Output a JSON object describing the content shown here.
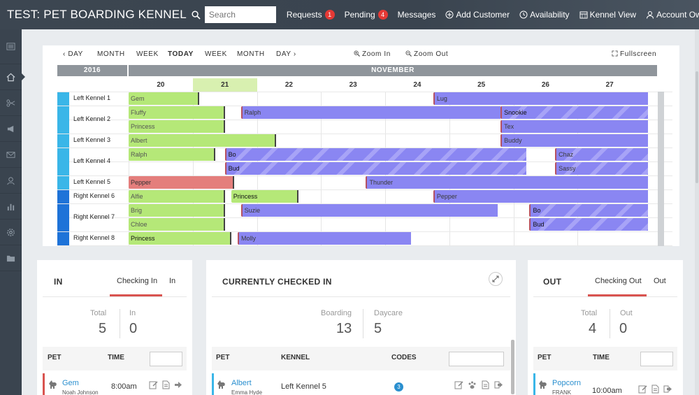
{
  "header": {
    "app_title": "TEST: PET BOARDING KENNEL",
    "search_placeholder": "Search",
    "nav": [
      {
        "label": "Requests",
        "badge": "1"
      },
      {
        "label": "Pending",
        "badge": "4"
      },
      {
        "label": "Messages"
      },
      {
        "label": "Add Customer",
        "icon": "plus-circle-icon"
      },
      {
        "label": "Availability",
        "icon": "clock-icon"
      },
      {
        "label": "Kennel View",
        "icon": "calendar-icon"
      },
      {
        "label": "Account Owner",
        "icon": "user-icon"
      }
    ]
  },
  "sidebar": {
    "items": [
      "menu-icon",
      "home-icon",
      "scissors-icon",
      "megaphone-icon",
      "envelope-icon",
      "tag-user-icon",
      "bar-chart-icon",
      "gear-icon",
      "folder-icon"
    ],
    "active": "home-icon"
  },
  "calendar": {
    "toolbar": {
      "prev_day": "DAY",
      "prev_month": "MONTH",
      "prev_week": "WEEK",
      "today": "TODAY",
      "next_week": "WEEK",
      "next_month": "MONTH",
      "next_day": "DAY",
      "zoom_in": "Zoom In",
      "zoom_out": "Zoom Out",
      "fullscreen": "Fullscreen"
    },
    "year": "2016",
    "month": "NOVEMBER",
    "days": [
      "20",
      "21",
      "22",
      "23",
      "24",
      "25",
      "26",
      "27"
    ],
    "today_day": "21",
    "kennels": [
      {
        "label": "Left Kennel 1",
        "color": "#3ab6e8"
      },
      {
        "label": "Left Kennel 2",
        "color": "#3ab6e8"
      },
      {
        "label": "Left Kennel 3",
        "color": "#3ab6e8"
      },
      {
        "label": "Left Kennel 4",
        "color": "#3ab6e8"
      },
      {
        "label": "Left Kennel 5",
        "color": "#3ab6e8"
      },
      {
        "label": "Right Kennel 6",
        "color": "#1e73d8"
      },
      {
        "label": "Right Kennel 7",
        "color": "#1e73d8"
      },
      {
        "label": "Right Kennel 8",
        "color": "#1e73d8"
      }
    ],
    "bookings": [
      {
        "pet": "Gem",
        "row": 0,
        "start": 0,
        "end": 1.1,
        "style": "green"
      },
      {
        "pet": "Lug",
        "row": 0,
        "start": 4.75,
        "end": 8.1,
        "style": "purple"
      },
      {
        "pet": "Fluffy",
        "row": 1,
        "start": 0,
        "end": 1.5,
        "style": "green"
      },
      {
        "pet": "Ralph",
        "row": 1,
        "start": 1.75,
        "end": 5.8,
        "style": "purple"
      },
      {
        "pet": "Snookie",
        "row": 1,
        "start": 5.8,
        "end": 8.1,
        "style": "purple striped darktext"
      },
      {
        "pet": "Princess",
        "row": 2,
        "start": 0,
        "end": 1.5,
        "style": "green"
      },
      {
        "pet": "Tex",
        "row": 2,
        "start": 5.8,
        "end": 8.1,
        "style": "purple"
      },
      {
        "pet": "Albert",
        "row": 3,
        "start": 0,
        "end": 2.3,
        "style": "green"
      },
      {
        "pet": "Buddy",
        "row": 3,
        "start": 5.8,
        "end": 8.1,
        "style": "purple"
      },
      {
        "pet": "Ralph",
        "row": 4,
        "start": 0,
        "end": 1.35,
        "style": "green"
      },
      {
        "pet": "Bo",
        "row": 4,
        "start": 1.5,
        "end": 6.2,
        "style": "purple striped darktext"
      },
      {
        "pet": "Chaz",
        "row": 4,
        "start": 6.65,
        "end": 8.1,
        "style": "purple striped"
      },
      {
        "pet": "Bud",
        "row": 5,
        "start": 1.5,
        "end": 6.2,
        "style": "purple striped darktext"
      },
      {
        "pet": "Sassy",
        "row": 5,
        "start": 6.65,
        "end": 8.1,
        "style": "purple striped"
      },
      {
        "pet": "Pepper",
        "row": 6,
        "start": 0,
        "end": 1.65,
        "style": "red"
      },
      {
        "pet": "Thunder",
        "row": 6,
        "start": 3.7,
        "end": 8.1,
        "style": "purple"
      },
      {
        "pet": "Alfie",
        "row": 7,
        "start": 0,
        "end": 1.5,
        "style": "green"
      },
      {
        "pet": "Princess",
        "row": 7,
        "start": 1.6,
        "end": 2.65,
        "style": "green darktext"
      },
      {
        "pet": "Pepper",
        "row": 7,
        "start": 4.75,
        "end": 8.1,
        "style": "purple"
      },
      {
        "pet": "Brig",
        "row": 8,
        "start": 0,
        "end": 1.5,
        "style": "green"
      },
      {
        "pet": "Suzie",
        "row": 8,
        "start": 1.75,
        "end": 5.75,
        "style": "purple"
      },
      {
        "pet": "Bo",
        "row": 8,
        "start": 6.25,
        "end": 8.1,
        "style": "purple striped darktext"
      },
      {
        "pet": "Chloe",
        "row": 9,
        "start": 0,
        "end": 1.5,
        "style": "green"
      },
      {
        "pet": "Bud",
        "row": 9,
        "start": 6.25,
        "end": 8.1,
        "style": "purple striped darktext"
      },
      {
        "pet": "Princess",
        "row": 10,
        "start": 0,
        "end": 1.6,
        "style": "green darktext"
      },
      {
        "pet": "Molly",
        "row": 10,
        "start": 1.7,
        "end": 4.4,
        "style": "purple"
      }
    ]
  },
  "in_panel": {
    "title": "IN",
    "tab_active": "Checking In",
    "tab_other": "In",
    "stat1_label": "Total",
    "stat1_value": "5",
    "stat2_label": "In",
    "stat2_value": "0",
    "col_pet": "PET",
    "col_time": "TIME",
    "row_pet": "Gem",
    "row_owner": "Noah Johnson",
    "row_time": "8:00am",
    "row_accent": "#d9534f"
  },
  "checked_panel": {
    "title": "CURRENTLY CHECKED IN",
    "stat1_label": "Boarding",
    "stat1_value": "13",
    "stat2_label": "Daycare",
    "stat2_value": "5",
    "col_pet": "PET",
    "col_kennel": "KENNEL",
    "col_codes": "CODES",
    "row_pet": "Albert",
    "row_owner": "Emma Hyde",
    "row_kennel": "Left Kennel 5",
    "row_code": "3",
    "row_accent": "#3ab6e8"
  },
  "out_panel": {
    "title": "OUT",
    "tab_active": "Checking Out",
    "tab_other": "Out",
    "stat1_label": "Total",
    "stat1_value": "4",
    "stat2_label": "Out",
    "stat2_value": "0",
    "col_pet": "PET",
    "col_time": "TIME",
    "row_pet": "Popcorn",
    "row_owner": "FRANK",
    "row_time": "10:00am",
    "row_accent": "#3ab6e8"
  }
}
